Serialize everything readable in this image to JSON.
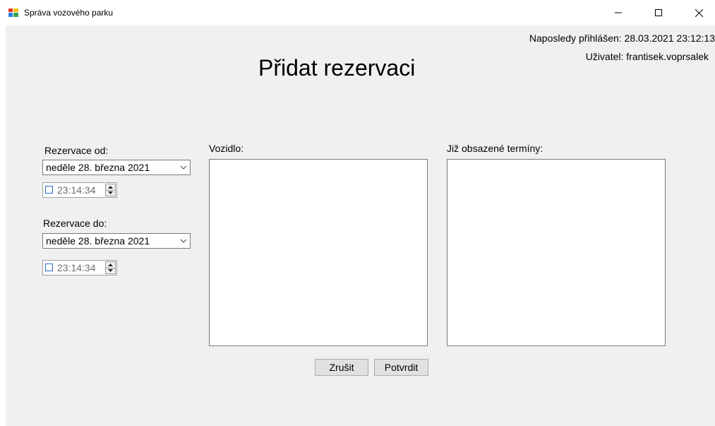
{
  "window": {
    "title": "Správa vozového parku",
    "minimize_label": "–",
    "maximize_label": "☐",
    "close_label": "✕"
  },
  "header": {
    "last_login": "Naposledy přihlášen: 28.03.2021 23:12:13",
    "user": "Uživatel: frantisek.voprsalek",
    "title": "Přidat rezervaci"
  },
  "reservation_from": {
    "label": "Rezervace od:",
    "date": "neděle 28.  března  2021",
    "time": "23:14:34",
    "time_checked": false
  },
  "reservation_to": {
    "label": "Rezervace do:",
    "date": "neděle 28.  března  2021",
    "time": "23:14:34",
    "time_checked": false
  },
  "vehicle": {
    "label": "Vozidlo:"
  },
  "occupied": {
    "label": "Již obsazené termíny:"
  },
  "buttons": {
    "cancel": "Zrušit",
    "confirm": "Potvrdit"
  },
  "icons": {
    "app": "app-icon",
    "dropdown": "chevron-down-icon",
    "spin_up": "spin-up-icon",
    "spin_down": "spin-down-icon"
  }
}
